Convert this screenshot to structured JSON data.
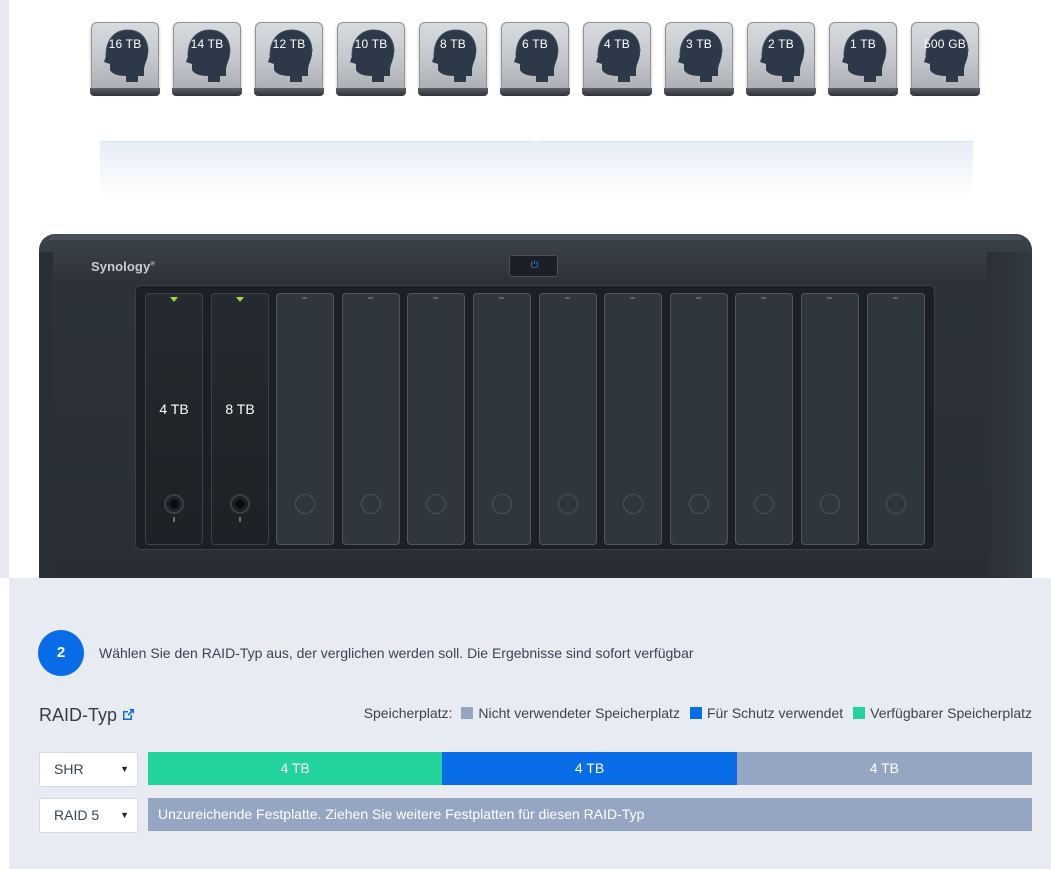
{
  "drives": [
    {
      "label": "16 TB"
    },
    {
      "label": "14 TB"
    },
    {
      "label": "12 TB"
    },
    {
      "label": "10 TB"
    },
    {
      "label": "8 TB"
    },
    {
      "label": "6 TB"
    },
    {
      "label": "4 TB"
    },
    {
      "label": "3 TB"
    },
    {
      "label": "2 TB"
    },
    {
      "label": "1 TB"
    },
    {
      "label": "500 GB"
    }
  ],
  "nas": {
    "brand": "Synology",
    "bays": [
      {
        "label": "4 TB",
        "filled": true
      },
      {
        "label": "8 TB",
        "filled": true
      },
      {
        "label": "",
        "filled": false
      },
      {
        "label": "",
        "filled": false
      },
      {
        "label": "",
        "filled": false
      },
      {
        "label": "",
        "filled": false
      },
      {
        "label": "",
        "filled": false
      },
      {
        "label": "",
        "filled": false
      },
      {
        "label": "",
        "filled": false
      },
      {
        "label": "",
        "filled": false
      },
      {
        "label": "",
        "filled": false
      },
      {
        "label": "",
        "filled": false
      }
    ]
  },
  "step": {
    "number": "2",
    "text": "Wählen Sie den RAID-Typ aus, der verglichen werden soll. Die Ergebnisse sind sofort verfügbar"
  },
  "raid": {
    "title": "RAID-Typ",
    "legend": {
      "label": "Speicherplatz:",
      "items": [
        {
          "label": "Nicht verwendeter Speicherplatz",
          "color": "#94a6c1"
        },
        {
          "label": "Für Schutz verwendet",
          "color": "#0a6de8"
        },
        {
          "label": "Verfügbarer Speicherplatz",
          "color": "#22d39b"
        }
      ]
    },
    "rows": [
      {
        "selected": "SHR",
        "segments": [
          {
            "label": "4 TB",
            "kind": "available",
            "fraction": 0.333,
            "color": "#22d39b"
          },
          {
            "label": "4 TB",
            "kind": "protection",
            "fraction": 0.333,
            "color": "#0a6de8"
          },
          {
            "label": "4 TB",
            "kind": "unused",
            "fraction": 0.334,
            "color": "#94a6c1"
          }
        ]
      },
      {
        "selected": "RAID 5",
        "message": "Unzureichende Festplatte. Ziehen Sie weitere Festplatten für diesen RAID-Typ"
      }
    ]
  }
}
